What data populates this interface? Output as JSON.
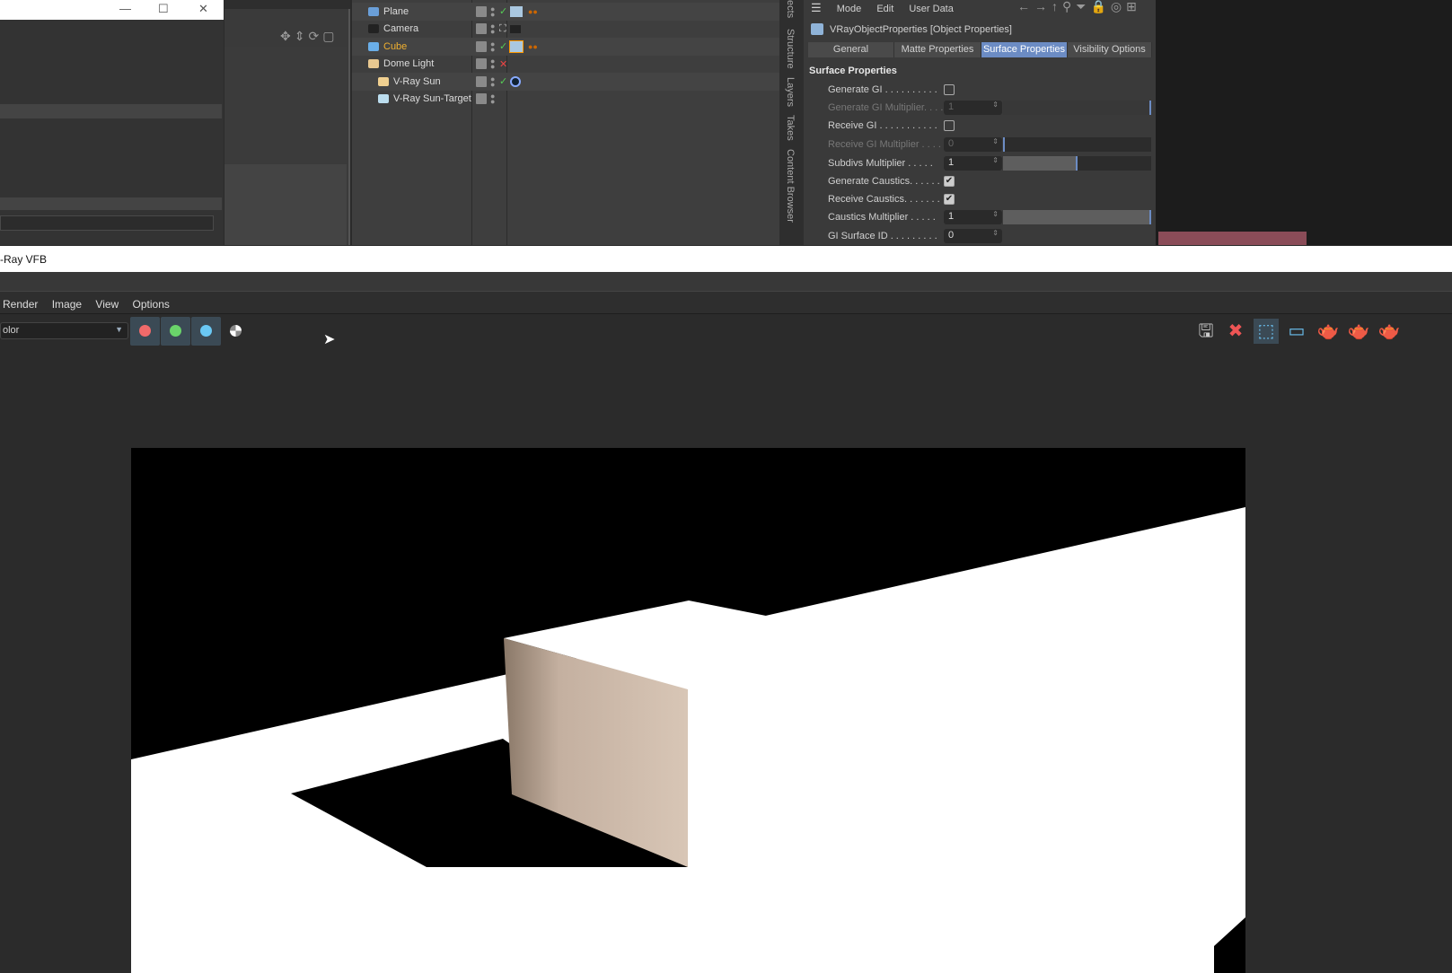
{
  "left_window": {
    "minimize": "—",
    "maximize": "☐",
    "close": "✕"
  },
  "object_manager": {
    "objects": [
      {
        "name": "Plane",
        "icon": "plane-icon",
        "status": "check",
        "color": "#dddddd"
      },
      {
        "name": "Camera",
        "icon": "camera-icon",
        "status": "target",
        "color": "#dddddd"
      },
      {
        "name": "Cube",
        "icon": "cube-icon",
        "status": "check",
        "color": "#f0b030",
        "selected_tag": true
      },
      {
        "name": "Dome Light",
        "icon": "dome-light-icon",
        "status": "x",
        "color": "#dddddd"
      },
      {
        "name": "V-Ray Sun",
        "icon": "sun-icon",
        "status": "check",
        "color": "#dddddd"
      },
      {
        "name": "V-Ray Sun-Target",
        "icon": "target-icon",
        "status": "",
        "color": "#dddddd"
      }
    ]
  },
  "side_tabs": [
    "ects",
    "Structure",
    "Layers",
    "Takes",
    "Content Browser"
  ],
  "attributes": {
    "menu": [
      "Mode",
      "Edit",
      "User Data"
    ],
    "object_title": "VRayObjectProperties [Object Properties]",
    "tabs": [
      "General",
      "Matte Properties",
      "Surface Properties",
      "Visibility Options"
    ],
    "active_tab": "Surface Properties",
    "section": "Surface Properties",
    "props": [
      {
        "label": "Generate GI . . . . . . . . . .",
        "type": "checkbox",
        "checked": false
      },
      {
        "label": "Generate GI Multiplier. . . .",
        "type": "number",
        "value": "1",
        "disabled": true,
        "fill": 1.0
      },
      {
        "label": "Receive GI . . . . . . . . . . .",
        "type": "checkbox",
        "checked": false
      },
      {
        "label": "Receive GI Multiplier . . . .",
        "type": "number",
        "value": "0",
        "disabled": true,
        "fill": 0.0
      },
      {
        "label": "Subdivs Multiplier  . . . . .",
        "type": "number",
        "value": "1",
        "fill": 0.5
      },
      {
        "label": "Generate Caustics. . . . . .",
        "type": "checkbox",
        "checked": true
      },
      {
        "label": "Receive Caustics. . . . . . .",
        "type": "checkbox",
        "checked": true
      },
      {
        "label": "Caustics Multiplier  . . . . .",
        "type": "number",
        "value": "1",
        "fill": 1.0
      },
      {
        "label": "GI Surface ID . . . . . . . . .",
        "type": "number",
        "value": "0"
      }
    ]
  },
  "vfb": {
    "title": "-Ray VFB",
    "menu": [
      "Render",
      "Image",
      "View",
      "Options"
    ],
    "channel": "olor",
    "channel_colors": [
      "#f06a6a",
      "#6ad46a",
      "#6ac8f4"
    ],
    "toolbar_icons": [
      "save-icon",
      "clear-image-icon",
      "region-render-icon",
      "track-mouse-icon",
      "render-teapot-icon",
      "stop-render-icon",
      "interactive-teapot-icon"
    ]
  }
}
